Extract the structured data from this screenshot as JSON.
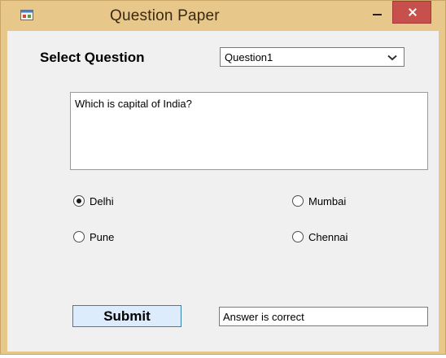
{
  "window": {
    "title": "Question Paper",
    "icon": "form-app-icon"
  },
  "form": {
    "select_label": "Select Question",
    "question_combo": {
      "selected": "Question1",
      "icon": "chevron-down-icon"
    },
    "question_text": "Which is capital of India?",
    "options": [
      {
        "label": "Delhi",
        "checked": true
      },
      {
        "label": "Mumbai",
        "checked": false
      },
      {
        "label": "Pune",
        "checked": false
      },
      {
        "label": "Chennai",
        "checked": false
      }
    ],
    "submit_label": "Submit",
    "result_text": "Answer is correct"
  },
  "colors": {
    "frame": "#e8c78a",
    "client": "#f0f0f0",
    "close_button": "#c7504c",
    "submit_bg": "#dcecfc",
    "submit_border": "#3c7fb1"
  }
}
